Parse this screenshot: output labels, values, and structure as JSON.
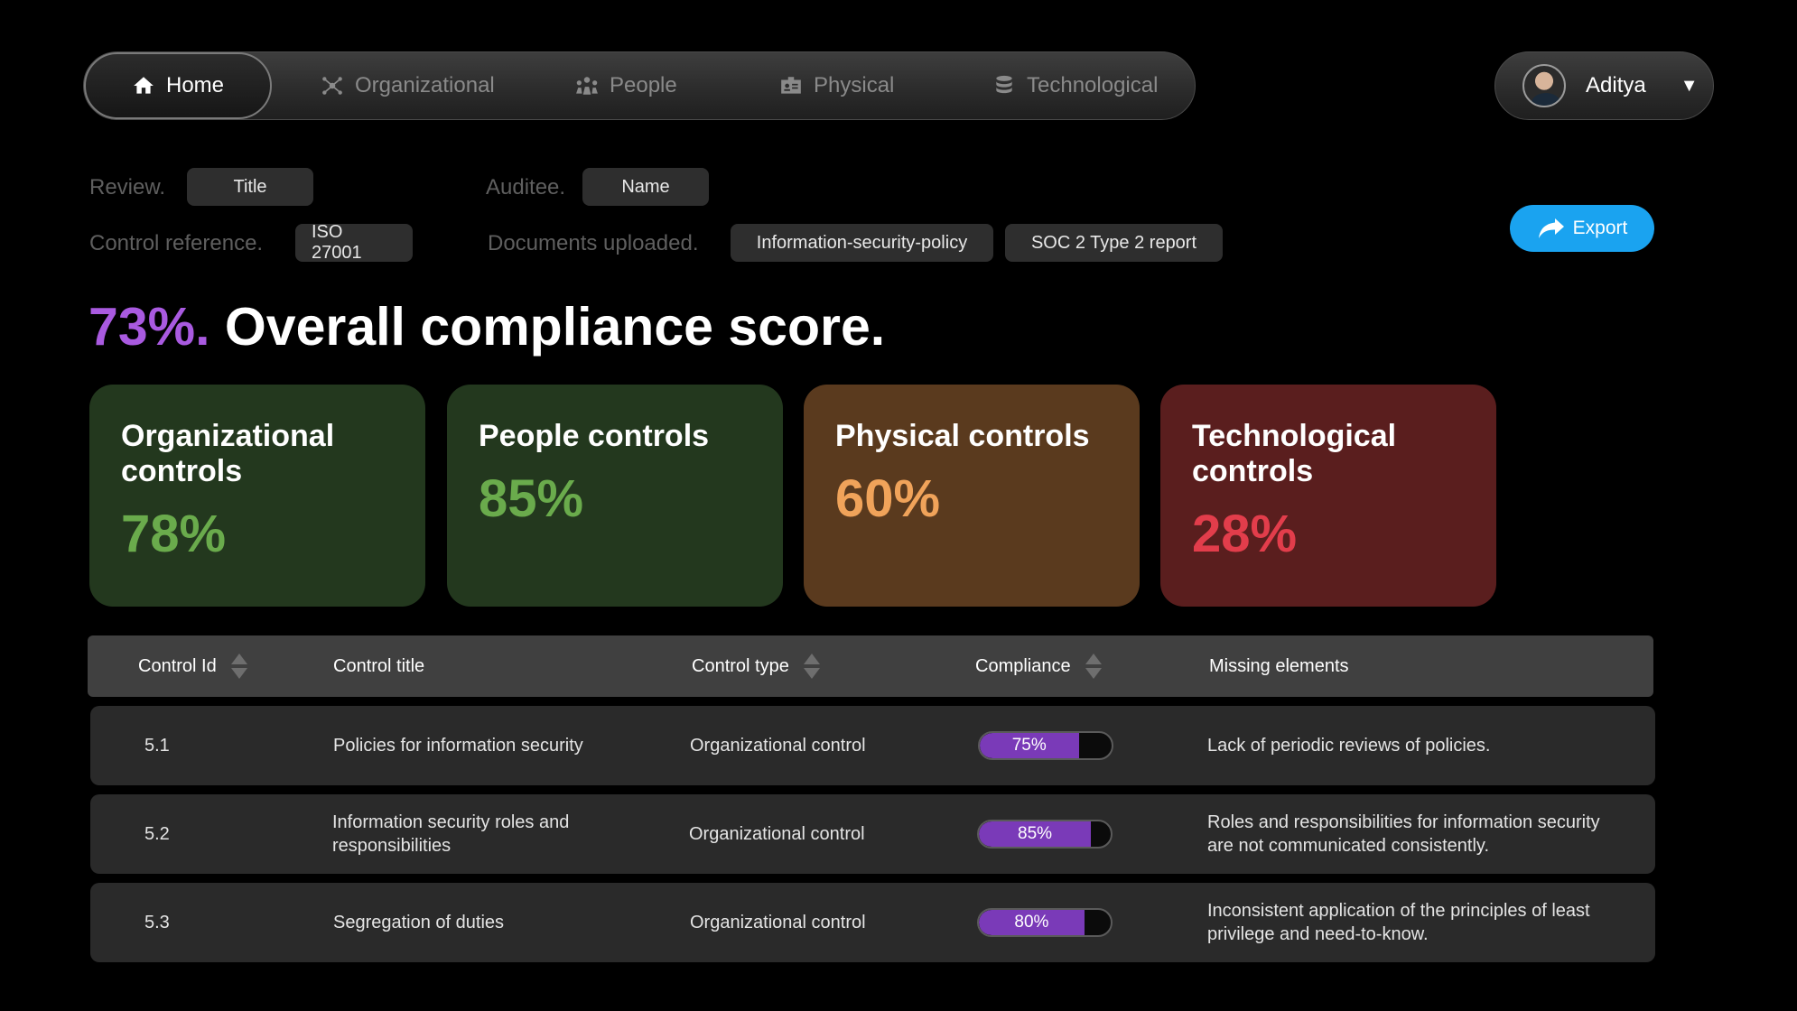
{
  "nav": {
    "items": [
      {
        "label": "Home",
        "icon": "home-icon"
      },
      {
        "label": "Organizational",
        "icon": "network-icon"
      },
      {
        "label": "People",
        "icon": "people-icon"
      },
      {
        "label": "Physical",
        "icon": "id-card-icon"
      },
      {
        "label": "Technological",
        "icon": "database-icon"
      }
    ],
    "active": "Home"
  },
  "user": {
    "name": "Aditya"
  },
  "meta": {
    "review_label": "Review.",
    "review_value": "Title",
    "auditee_label": "Auditee.",
    "auditee_value": "Name",
    "control_ref_label": "Control reference.",
    "control_ref_value": "ISO 27001",
    "documents_label": "Documents uploaded.",
    "documents": [
      "Information-security-policy",
      "SOC 2 Type 2 report"
    ]
  },
  "export_label": "Export",
  "headline": {
    "percent": "73%.",
    "text": " Overall compliance score."
  },
  "cards": [
    {
      "title": "Organizational controls",
      "value": "78%",
      "bg": "#23381e",
      "color": "#6aab4c"
    },
    {
      "title": "People controls",
      "value": "85%",
      "bg": "#23381e",
      "color": "#6aab4c"
    },
    {
      "title": "Physical controls",
      "value": "60%",
      "bg": "#5a3a1e",
      "color": "#f0a35a"
    },
    {
      "title": "Technological controls",
      "value": "28%",
      "bg": "#5a1e1e",
      "color": "#e23d4b"
    }
  ],
  "table": {
    "headers": [
      "Control Id",
      "Control title",
      "Control type",
      "Compliance",
      "Missing elements"
    ],
    "rows": [
      {
        "id": "5.1",
        "title": "Policies for information security",
        "type": "Organizational control",
        "compliance_label": "75%",
        "compliance": 0.75,
        "missing": "Lack of periodic reviews of policies."
      },
      {
        "id": "5.2",
        "title": "Information security roles and responsibilities",
        "type": "Organizational control",
        "compliance_label": "85%",
        "compliance": 0.85,
        "missing": "Roles and responsibilities for information security are not communicated consistently."
      },
      {
        "id": "5.3",
        "title": "Segregation of duties",
        "type": "Organizational control",
        "compliance_label": "80%",
        "compliance": 0.8,
        "missing": "Inconsistent application of the principles of least privilege and need-to-know."
      }
    ]
  },
  "colors": {
    "accent_purple": "#a95ae0",
    "export_blue": "#1aa3f0",
    "bar_fill": "#7a3ab8"
  }
}
